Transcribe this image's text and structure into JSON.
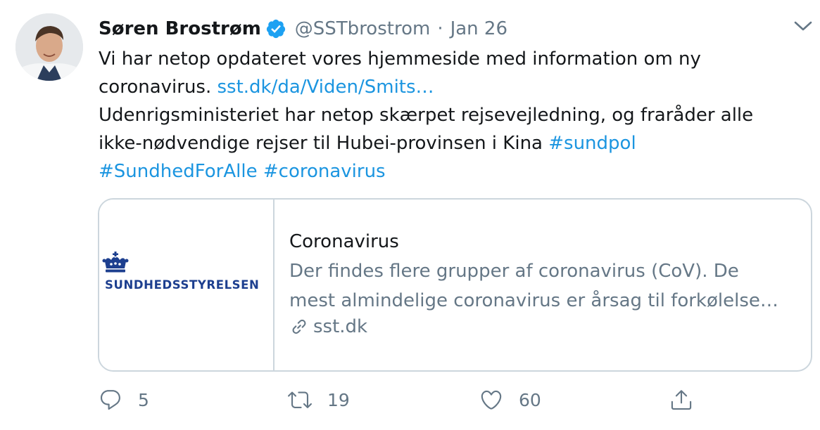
{
  "tweet": {
    "author_name": "Søren Brostrøm",
    "handle": "@SSTbrostrom",
    "separator": "·",
    "date": "Jan 26",
    "text": {
      "line1": "Vi har netop opdateret vores hjemmeside med information om ny",
      "line2_plain": "coronavirus. ",
      "line2_link": "sst.dk/da/Viden/Smits…",
      "line3": "Udenrigsministeriet har netop skærpet rejsevejledning, og fraråder alle",
      "line4_plain": "ikke-nødvendige rejser til Hubei-provinsen i Kina ",
      "line4_hashtag": "#sundpol",
      "hashtag2": "#SundhedForAlle",
      "hashtag3": "#coronavirus"
    },
    "card": {
      "logo_text": "SUNDHEDSSTYRELSEN",
      "title": "Coronavirus",
      "description_line1": "Der findes flere grupper af coronavirus (CoV). De",
      "description_line2": "mest almindelige coronavirus er årsag til forkølelse…",
      "domain": "sst.dk"
    },
    "actions": {
      "replies": "5",
      "retweets": "19",
      "likes": "60"
    }
  },
  "icons": {
    "verified": "verified-badge-icon",
    "caret": "chevron-down-icon",
    "reply": "reply-icon",
    "retweet": "retweet-icon",
    "like": "heart-icon",
    "share": "share-icon",
    "link": "link-icon",
    "crown": "crown-icon"
  },
  "colors": {
    "link": "#1b95e0",
    "secondary": "#657786",
    "verified": "#1da1f2",
    "border": "#ccd6dd",
    "logo": "#1d3f8f"
  }
}
